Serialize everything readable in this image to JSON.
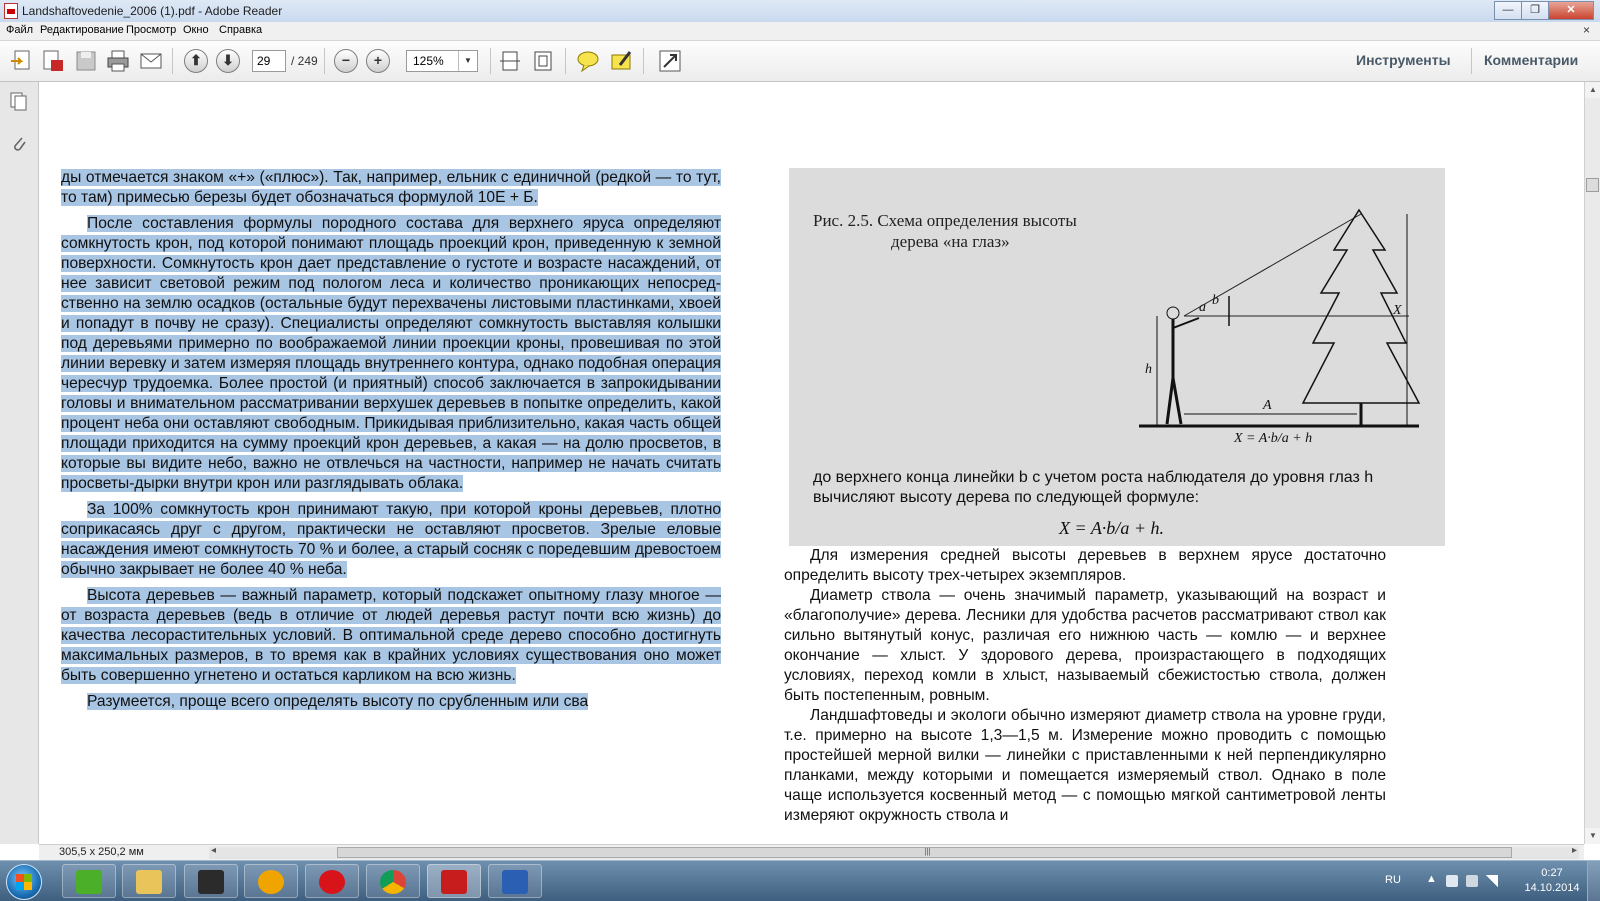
{
  "window": {
    "title": "Landshaftovedenie_2006 (1).pdf - Adobe Reader",
    "minimize_label": "—",
    "restore_label": "❐",
    "close_label": "✕"
  },
  "menu": {
    "items": [
      "Файл",
      "Редактирование",
      "Просмотр",
      "Окно",
      "Справка"
    ],
    "close_label": "×"
  },
  "toolbar": {
    "page_current": "29",
    "page_total": "/ 249",
    "zoom": "125%",
    "zoom_dropdown": "▼",
    "tools_label": "Инструменты",
    "comments_label": "Комментарии",
    "prev_page_glyph": "⬆",
    "next_page_glyph": "⬇",
    "zoom_out_glyph": "−",
    "zoom_in_glyph": "+"
  },
  "document": {
    "left_paragraphs": [
      "ды отмечается знаком «+» («плюс»). Так, например, ельник с единичной (редкой — то тут, то там) примесью березы будет обозначаться форму­лой 10Е + Б.",
      "После составления формулы породного состава для верхнего яруса определяют сомкнутость крон, под которой понимают площадь проек­ций крон, приведенную к земной поверхности. Сомкнутость крон дает представление о густоте и возрасте насаждений, от нее зависит свето­вой режим под пологом леса и количество проникающих непосред­ственно на землю осадков (остальные будут перехвачены листовыми пластинками, хвоей и попадут в почву не сразу). Специалисты опреде­ляют сомкнутость выставляя колышки под деревьями примерно по во­ображаемой линии проекции кроны, провешивая по этой линии веревку и затем измеряя площадь внутреннего контура, однако подобная операция чересчур трудоемка. Более простой (и приятный) способ зак­лючается в запрокидывании головы и внимательном рассматривании верхушек деревьев в попытке определить, какой процент неба они ос­тавляют свободным. Прикидывая приблизительно, какая часть общей площади приходится на сумму проекций крон деревьев, а какая — на долю просветов, в которые вы видите небо, важно не отвлечься на част­ности, например не начать считать просветы-дырки внутри крон или разглядывать облака.",
      "За 100% сомкнутость крон принимают такую, при которой кроны де­ревьев, плотно соприкасаясь друг с другом, практически не оставляют просветов. Зрелые еловые насаждения имеют сомкнутость 70 % и более, а старый сосняк с поредевшим древостоем обычно закрывает не более 40 % неба.",
      "Высота деревьев — важный параметр, который подскажет опытному глазу многое — от возраста деревьев (ведь в отличие от людей деревья растут почти всю жизнь) до качества лесорастительных условий. В опти­мальной среде дерево способно достигнуть максимальных размеров, в то время как в крайних условиях существования оно может быть совер­шенно угнетено и остаться карликом на всю жизнь.",
      "Разумеется, проще всего определять высоту по срубленным или сва­"
    ],
    "figure": {
      "caption_line1": "Рис. 2.5. Схема определения высоты",
      "caption_line2": "дерева «на глаз»",
      "label_a": "a",
      "label_b": "b",
      "label_h": "h",
      "label_x": "X",
      "label_A": "A",
      "diagram_formula": "X = A·b/a + h",
      "text": "до верхнего конца линейки b с учетом роста наблюдателя до уровня глаз h вычисляют высоту дерева по следующей формуле:",
      "formula": "X = A·b/a + h."
    },
    "right_paragraphs": [
      "Для измерения средней высоты деревьев в верхнем ярусе достаточно определить высоту трех-четырех экземпляров.",
      "Диаметр ствола — очень значимый параметр, указывающий на воз­раст и «благополучие» дерева. Лесники для удобства расчетов рассмат­ривают ствол как сильно вытянутый конус, различая его нижнюю часть — комлю — и верхнее окончание — хлыст. У здорового дерева, произрас­тающего в подходящих условиях, переход комли в хлыст, называемый сбежистостью ствола, должен быть постепенным, ровным.",
      "Ландшафтоведы и экологи обычно измеряют диаметр ствола на уров­не груди, т.е. примерно на высоте 1,3—1,5 м. Измерение можно прово­дить с помощью простейшей мерной вилки — линейки с приставленны­ми к ней перпендикулярно планками, между которыми и помещается из­меряемый ствол. Однако в поле чаще используется косвенный метод — с помощью мягкой сантиметровой ленты измеряют окружность ствола и"
    ]
  },
  "statusbar": {
    "dimensions": "305,5 x 250,2 мм",
    "scroll_left": "◂",
    "scroll_right": "▸",
    "grip": "|||"
  },
  "taskbar": {
    "language": "RU",
    "time": "0:27",
    "date": "14.10.2014"
  },
  "colors": {
    "selection": "#a8c5e4",
    "toolbar_link": "#4a5968",
    "taskbar": "#4f6f90"
  }
}
